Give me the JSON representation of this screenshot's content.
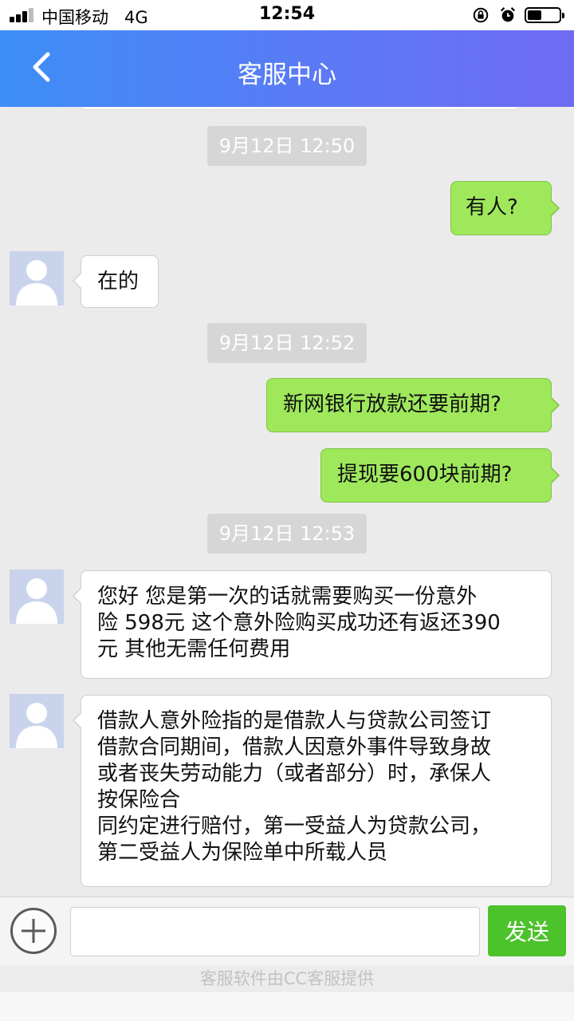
{
  "status_bar": {
    "carrier": "中国移动",
    "network": "4G",
    "time": "12:54",
    "battery_level": 0.45
  },
  "header": {
    "title": "客服中心",
    "back_icon": "chevron-left-icon"
  },
  "messages": [
    {
      "type": "timestamp",
      "text": "9月12日 12:50"
    },
    {
      "type": "outgoing",
      "text": "有人?"
    },
    {
      "type": "incoming",
      "text": "在的"
    },
    {
      "type": "timestamp",
      "text": "9月12日 12:52"
    },
    {
      "type": "outgoing",
      "text": "新网银行放款还要前期?"
    },
    {
      "type": "outgoing",
      "text": "提现要600块前期?"
    },
    {
      "type": "timestamp",
      "text": "9月12日 12:53"
    },
    {
      "type": "incoming",
      "text": "您好 您是第一次的话就需要购买一份意外\n险 598元 这个意外险购买成功还有返还390\n元 其他无需任何费用"
    },
    {
      "type": "incoming",
      "text": "借款人意外险指的是借款人与贷款公司签订\n借款合同期间，借款人因意外事件导致身故\n或者丧失劳动能力（或者部分）时，承保人\n按保险合\n同约定进行赔付，第一受益人为贷款公司，\n第二受益人为保险单中所载人员"
    }
  ],
  "input_bar": {
    "plus_icon": "plus-circle-icon",
    "input_value": "",
    "input_placeholder": "",
    "send_label": "发送"
  },
  "footer": {
    "text": "客服软件由CC客服提供"
  },
  "colors": {
    "header_start": "#3d8ef7",
    "header_end": "#6f6cf3",
    "outgoing_bubble": "#9fe85c",
    "send_button": "#4cc22b"
  }
}
